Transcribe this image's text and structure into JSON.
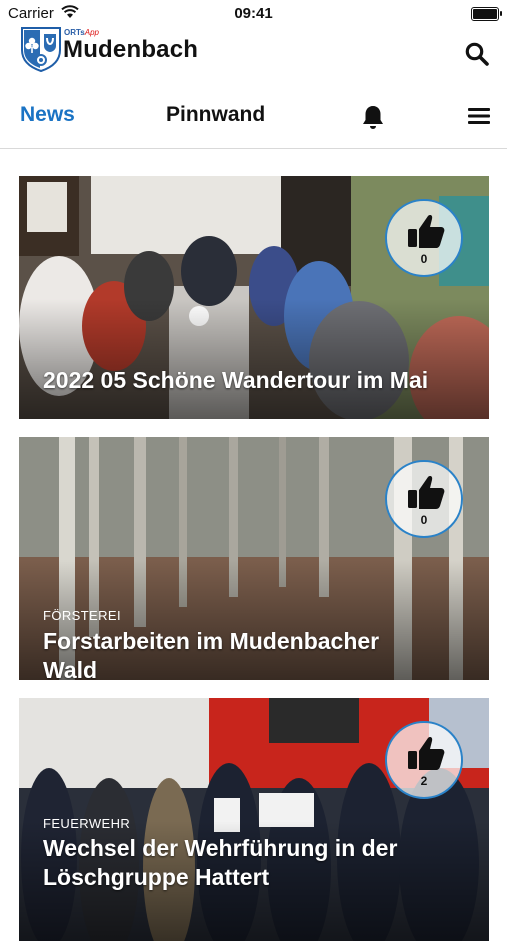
{
  "status": {
    "carrier": "Carrier",
    "time": "09:41"
  },
  "header": {
    "brand_small": "ORTs",
    "brand_app": "App",
    "title": "Mudenbach"
  },
  "nav": {
    "tab_news": "News",
    "tab_pinnwand": "Pinnwand"
  },
  "news": [
    {
      "category": "",
      "title": "2022 05 Schöne Wandertour im Mai",
      "likes": "0"
    },
    {
      "category": "FÖRSTEREI",
      "title": "Forstarbeiten im Mudenbacher Wald",
      "likes": "0"
    },
    {
      "category": "FEUERWEHR",
      "title": "Wechsel der Wehrführung in der Löschgruppe Hattert",
      "likes": "2"
    }
  ],
  "icons": {
    "search": "search-icon",
    "bell": "bell-icon",
    "menu": "menu-icon",
    "like": "thumbs-up-icon",
    "wifi": "wifi-icon",
    "battery": "battery-icon"
  },
  "colors": {
    "accent": "#1a73c4",
    "like_border": "#2a82c8"
  }
}
